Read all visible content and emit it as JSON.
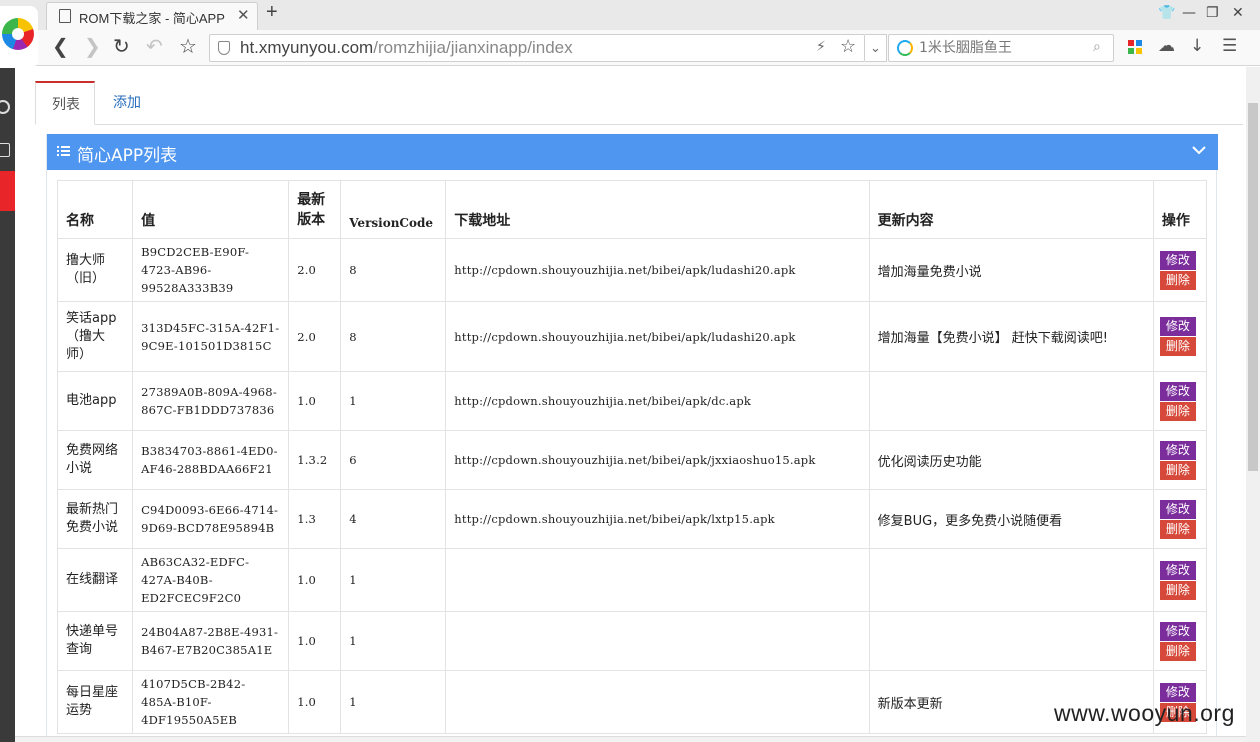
{
  "browser": {
    "tab_title": "ROM下载之家 - 简心APP",
    "tab_close": "✕",
    "new_tab": "+",
    "url_host": "ht.xmyunyou.com",
    "url_path": "/romzhijia/jianxinapp/index",
    "search_placeholder": "1米长胭脂鱼王"
  },
  "page": {
    "tab_list": "列表",
    "tab_add": "添加",
    "panel_title": "简心APP列表"
  },
  "table": {
    "headers": {
      "name": "名称",
      "value": "值",
      "version": "最新版本",
      "code": "VersionCode",
      "url": "下载地址",
      "update": "更新内容",
      "op": "操作"
    },
    "edit_label": "修改",
    "delete_label": "删除",
    "rows": [
      {
        "name": "撸大师（旧）",
        "value": "B9CD2CEB-E90F-4723-AB96-99528A333B39",
        "version": "2.0",
        "code": "8",
        "url": "http://cpdown.shouyouzhijia.net/bibei/apk/ludashi20.apk",
        "update": "增加海量免费小说"
      },
      {
        "name": "笑话app（撸大师）",
        "value": "313D45FC-315A-42F1-9C9E-101501D3815C",
        "version": "2.0",
        "code": "8",
        "url": "http://cpdown.shouyouzhijia.net/bibei/apk/ludashi20.apk",
        "update": "增加海量【免费小说】 赶快下载阅读吧!"
      },
      {
        "name": "电池app",
        "value": "27389A0B-809A-4968-867C-FB1DDD737836",
        "version": "1.0",
        "code": "1",
        "url": "http://cpdown.shouyouzhijia.net/bibei/apk/dc.apk",
        "update": ""
      },
      {
        "name": "免费网络小说",
        "value": "B3834703-8861-4ED0-AF46-288BDAA66F21",
        "version": "1.3.2",
        "code": "6",
        "url": "http://cpdown.shouyouzhijia.net/bibei/apk/jxxiaoshuo15.apk",
        "update": "优化阅读历史功能"
      },
      {
        "name": "最新热门免费小说",
        "value": "C94D0093-6E66-4714-9D69-BCD78E95894B",
        "version": "1.3",
        "code": "4",
        "url": "http://cpdown.shouyouzhijia.net/bibei/apk/lxtp15.apk",
        "update": "修复BUG，更多免费小说随便看"
      },
      {
        "name": "在线翻译",
        "value": "AB63CA32-EDFC-427A-B40B-ED2FCEC9F2C0",
        "version": "1.0",
        "code": "1",
        "url": "",
        "update": ""
      },
      {
        "name": "快递单号查询",
        "value": "24B04A87-2B8E-4931-B467-E7B20C385A1E",
        "version": "1.0",
        "code": "1",
        "url": "",
        "update": ""
      },
      {
        "name": "每日星座运势",
        "value": "4107D5CB-2B42-485A-B10F-4DF19550A5EB",
        "version": "1.0",
        "code": "1",
        "url": "",
        "update": "新版本更新"
      }
    ]
  },
  "watermark": "www.wooyun.org",
  "colors": {
    "panel_header": "#4f96f0",
    "edit_button": "#7b2d9c",
    "delete_button": "#d6493a",
    "active_tab_border": "#c9302c",
    "link": "#2a6ebd"
  }
}
